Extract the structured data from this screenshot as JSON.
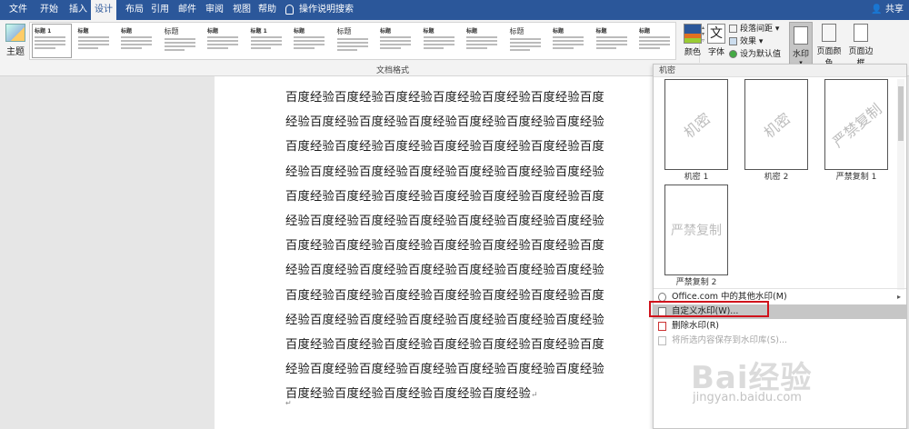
{
  "tabs": [
    "文件",
    "开始",
    "插入",
    "设计",
    "布局",
    "引用",
    "邮件",
    "审阅",
    "视图",
    "帮助"
  ],
  "active_tab": "设计",
  "tell_me": "操作说明搜索",
  "share": "共享",
  "ribbon": {
    "theme_label": "主题",
    "style_thumbs": [
      {
        "title": "标题 1"
      },
      {
        "title": "标题"
      },
      {
        "title": "标题"
      },
      {
        "title": "标题"
      },
      {
        "title": "标题"
      },
      {
        "title": "标题 1"
      },
      {
        "title": "标题"
      },
      {
        "title": "标题"
      },
      {
        "title": "标题"
      },
      {
        "title": "标题"
      },
      {
        "title": "标题"
      },
      {
        "title": "标题"
      },
      {
        "title": "标题"
      },
      {
        "title": "标题"
      },
      {
        "title": "标题"
      }
    ],
    "group_label": "文档格式",
    "colors_label": "颜色",
    "fonts_label": "字体",
    "paragraph_spacing": "段落间距",
    "effects": "效果",
    "set_default": "设为默认值",
    "watermark_label": "水印",
    "page_color_label": "页面颜色",
    "page_border_label": "页面边框"
  },
  "document": {
    "text": "百度经验百度经验百度经验百度经验百度经验百度经验百度经验百度经验百度经验百度经验百度经验百度经验百度经验百度经验百度经验百度经验百度经验百度经验百度经验百度经验百度经验百度经验百度经验百度经验百度经验百度经验百度经验百度经验百度经验百度经验百度经验百度经验百度经验百度经验百度经验百度经验百度经验百度经验百度经验百度经验百度经验百度经验百度经验百度经验百度经验百度经验百度经验百度经验百度经验百度经验百度经验百度经验百度经验百度经验百度经验百度经验百度经验百度经验百度经验百度经验百度经验百度经验百度经验百度经验百度经验百度经验百度经验百度经验百度经验百度经验百度经验百度经验百度经验百度经验百度经验百度经验百度经验百度经验百度经验百度经验百度经验百度经验百度经验"
  },
  "watermark_menu": {
    "header": "机密",
    "tiles": [
      {
        "label": "机密 1",
        "mark": "机密"
      },
      {
        "label": "机密 2",
        "mark": "机密"
      },
      {
        "label": "严禁复制 1",
        "mark": "严禁复制"
      },
      {
        "label": "严禁复制 2",
        "mark": "严禁复制"
      }
    ],
    "items": [
      {
        "label": "Office.com 中的其他水印(M)",
        "has_arrow": true
      },
      {
        "label": "自定义水印(W)..."
      },
      {
        "label": "删除水印(R)"
      },
      {
        "label": "将所选内容保存到水印库(S)..."
      }
    ]
  },
  "site_watermark": {
    "logo": "Bai经验",
    "url": "jingyan.baidu.com"
  }
}
